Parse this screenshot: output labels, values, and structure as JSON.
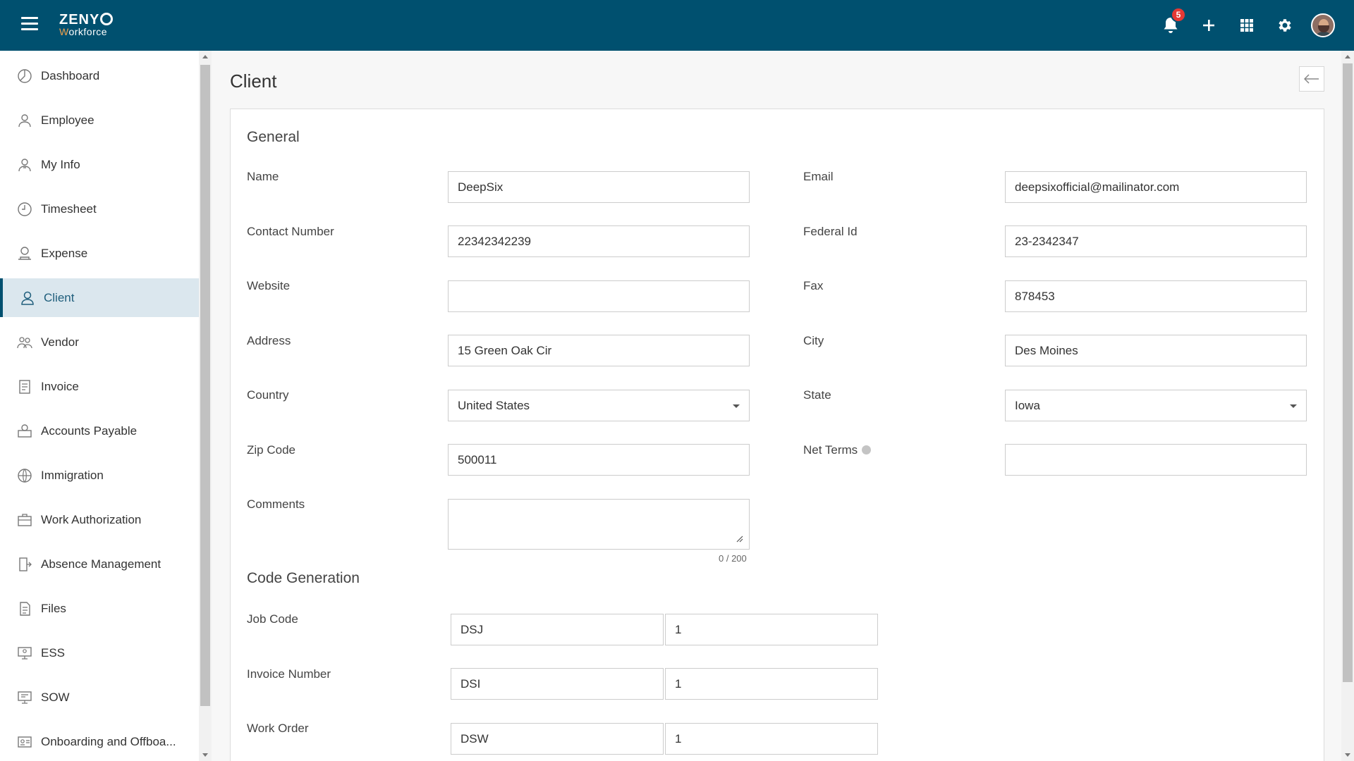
{
  "header": {
    "logo_main": "ZENY",
    "logo_w": "W",
    "logo_sub": "orkforce",
    "notification_count": "5",
    "icons": [
      "menu-icon",
      "bell-icon",
      "plus-icon",
      "apps-grid-icon",
      "gear-icon",
      "user-avatar"
    ]
  },
  "sidebar": {
    "items": [
      {
        "label": "Dashboard",
        "icon": "dashboard-icon"
      },
      {
        "label": "Employee",
        "icon": "employee-icon"
      },
      {
        "label": "My Info",
        "icon": "my-info-icon"
      },
      {
        "label": "Timesheet",
        "icon": "clock-icon"
      },
      {
        "label": "Expense",
        "icon": "expense-icon"
      },
      {
        "label": "Client",
        "icon": "client-icon",
        "active": true
      },
      {
        "label": "Vendor",
        "icon": "vendor-icon"
      },
      {
        "label": "Invoice",
        "icon": "invoice-icon"
      },
      {
        "label": "Accounts Payable",
        "icon": "accounts-payable-icon"
      },
      {
        "label": "Immigration",
        "icon": "globe-icon"
      },
      {
        "label": "Work Authorization",
        "icon": "briefcase-icon"
      },
      {
        "label": "Absence Management",
        "icon": "door-icon"
      },
      {
        "label": "Files",
        "icon": "file-icon"
      },
      {
        "label": "ESS",
        "icon": "ess-icon"
      },
      {
        "label": "SOW",
        "icon": "sow-icon"
      },
      {
        "label": "Onboarding and Offboa...",
        "icon": "id-card-icon"
      }
    ]
  },
  "page": {
    "title": "Client"
  },
  "general": {
    "title": "General",
    "name_label": "Name",
    "name_value": "DeepSix",
    "email_label": "Email",
    "email_value": "deepsixofficial@mailinator.com",
    "contact_label": "Contact Number",
    "contact_value": "22342342239",
    "federal_label": "Federal Id",
    "federal_value": "23-2342347",
    "website_label": "Website",
    "website_value": "",
    "fax_label": "Fax",
    "fax_value": "878453",
    "address_label": "Address",
    "address_value": "15 Green Oak Cir",
    "city_label": "City",
    "city_value": "Des Moines",
    "country_label": "Country",
    "country_value": "United States",
    "state_label": "State",
    "state_value": "Iowa",
    "zip_label": "Zip Code",
    "zip_value": "500011",
    "netterms_label": "Net Terms",
    "netterms_value": "",
    "comments_label": "Comments",
    "comments_value": "",
    "comments_counter": "0 / 200"
  },
  "code_generation": {
    "title": "Code Generation",
    "job_label": "Job Code",
    "job_prefix": "DSJ",
    "job_number": "1",
    "invoice_label": "Invoice Number",
    "invoice_prefix": "DSI",
    "invoice_number": "1",
    "workorder_label": "Work Order",
    "workorder_prefix": "DSW",
    "workorder_number": "1"
  }
}
